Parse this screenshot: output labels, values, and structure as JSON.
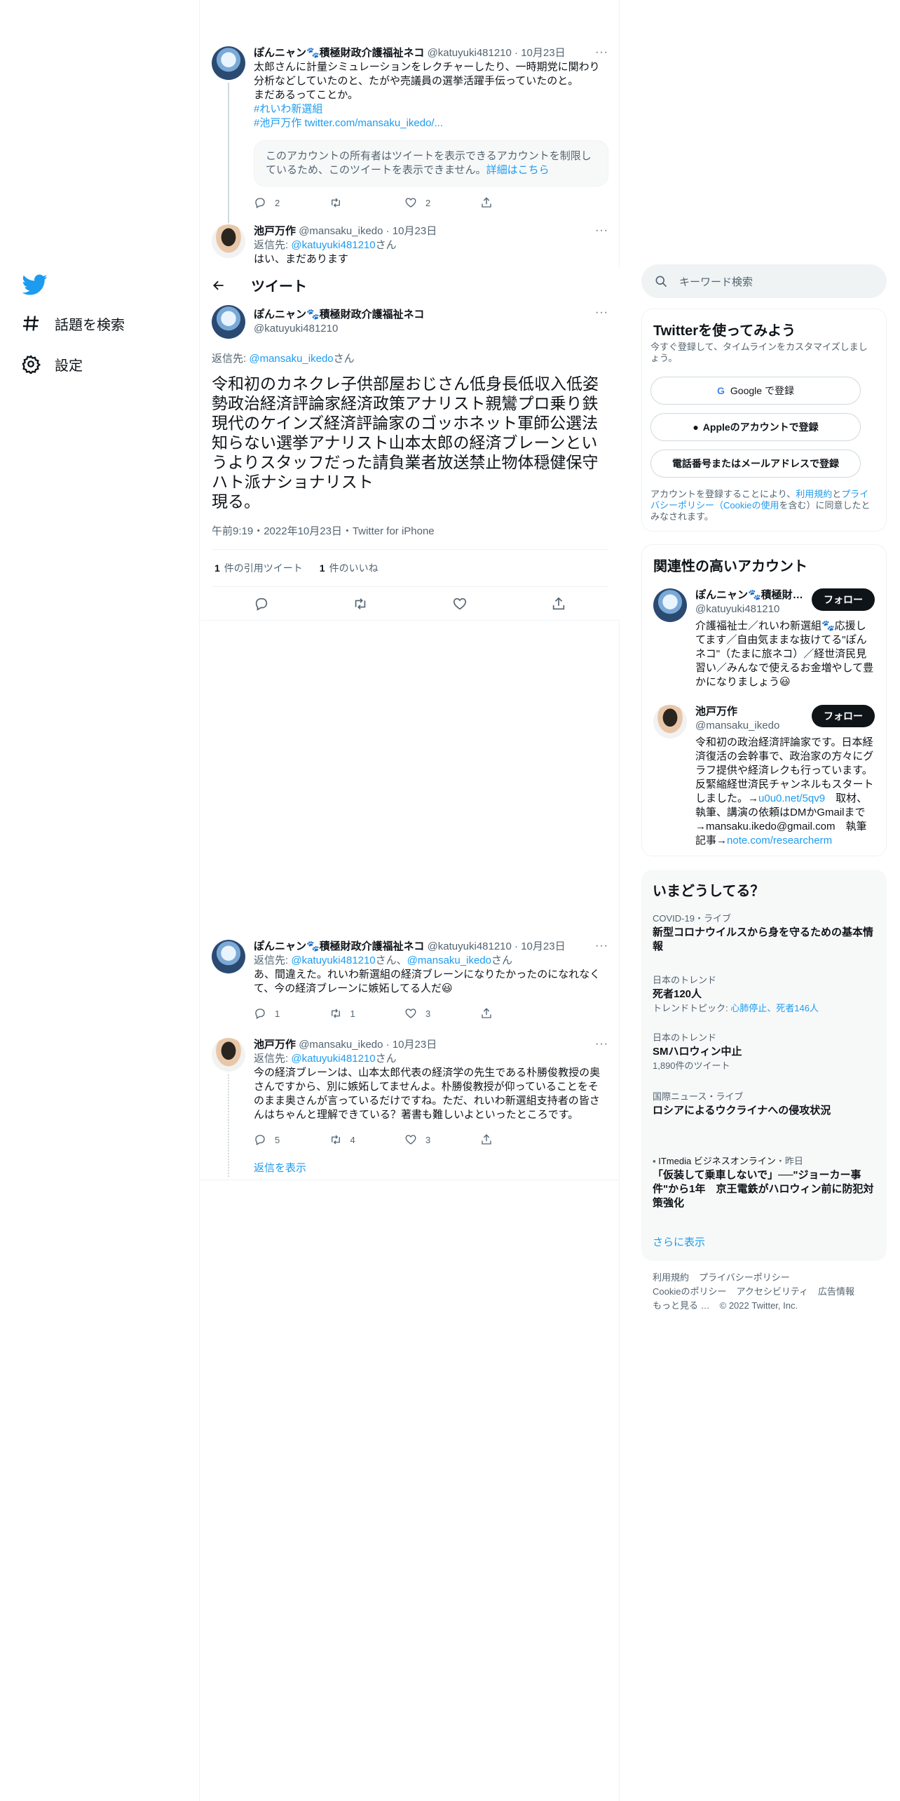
{
  "nav": {
    "search_topics": "話題を検索",
    "settings": "設定"
  },
  "thread_top": {
    "author": "ぽんニャン🐾積極財政介護福祉ネコ",
    "handle": "@katuyuki481210",
    "date": "10月23日",
    "text": [
      "太郎さんに計量シミュレーションをレクチャーしたり、一時期党に関わり",
      "分析などしていたのと、たがや売議員の選挙活躍手伝っていたのと。",
      "まだあるってことか。"
    ],
    "hashtag": "#れいわ新選組",
    "link_line": "#池戸万作 twitter.com/mansaku_ikedo/...",
    "notice": "このアカウントの所有者はツイートを表示できるアカウントを制限しているため、このツイートを表示できません。",
    "notice_link": "詳細はこちら",
    "replies": "2",
    "likes": "2"
  },
  "thread_second": {
    "author": "池戸万作",
    "handle": "@mansaku_ikedo",
    "date": "10月23日",
    "reply_prefix": "返信先:",
    "reply_to": "@katuyuki481210",
    "reply_suffix": "さん",
    "text": "はい、まだあります"
  },
  "header": {
    "title": "ツイート"
  },
  "main": {
    "author": "ぽんニャン🐾積極財政介護福祉ネコ",
    "handle": "@katuyuki481210",
    "reply_prefix": "返信先:",
    "reply_to": "@mansaku_ikedo",
    "reply_suffix": "さん",
    "text": "令和初のカネクレ子供部屋おじさん低身長低収入低姿勢政治経済評論家経済政策アナリスト親鸞プロ乗り鉄現代のケインズ経済評論家のゴッホネット軍師公選法知らない選挙アナリスト山本太郎の経済ブレーンというよりスタッフだった請負業者放送禁止物体穏健保守ハト派ナショナリスト\n現る。",
    "meta": "午前9:19・2022年10月23日・Twitter for iPhone",
    "quote_count": "1",
    "quote_label": "件の引用ツイート",
    "like_count": "1",
    "like_label": "件のいいね"
  },
  "replies": [
    {
      "author": "ぽんニャン🐾積極財政介護福祉ネコ",
      "handle": "@katuyuki481210",
      "date": "10月23日",
      "reply_prefix": "返信先:",
      "reply_to_1": "@katuyuki481210",
      "reply_mid": "さん、",
      "reply_to_2": "@mansaku_ikedo",
      "reply_suffix": "さん",
      "text": "あ、間違えた。れいわ新選組の経済ブレーンになりたかったのになれなくて、今の経済ブレーンに嫉妬してる人だ😃",
      "replies": "1",
      "retweets": "1",
      "likes": "3"
    },
    {
      "author": "池戸万作",
      "handle": "@mansaku_ikedo",
      "date": "10月23日",
      "reply_prefix": "返信先:",
      "reply_to": "@katuyuki481210",
      "reply_suffix": "さん",
      "text": "今の経済ブレーンは、山本太郎代表の経済学の先生である朴勝俊教授の奥さんですから、別に嫉妬してませんよ。朴勝俊教授が仰っていることをそのまま奥さんが言っているだけですね。ただ、れいわ新選組支持者の皆さんはちゃんと理解できている？著書も難しいよといったところです。",
      "replies": "5",
      "retweets": "4",
      "likes": "3"
    }
  ],
  "show_replies": "返信を表示",
  "right": {
    "search_placeholder": "キーワード検索",
    "signup": {
      "title": "Twitterを使ってみよう",
      "subtitle": "今すぐ登録して、タイムラインをカスタマイズしましょう。",
      "google": "Google で登録",
      "apple": "Appleのアカウントで登録",
      "phone": "電話番号またはメールアドレスで登録",
      "legal_1": "アカウントを登録することにより、",
      "terms": "利用規約",
      "and": "と",
      "privacy": "プライバシーポリシー（Cookieの使用",
      "legal_2": "を含む）に同意したとみなされます。"
    },
    "related": {
      "title": "関連性の高いアカウント",
      "follow": "フォロー",
      "accounts": [
        {
          "name": "ぽんニャン🐾積極財政…",
          "handle": "@katuyuki481210",
          "bio": "介護福祉士／れいわ新選組🐾応援してます／自由気ままな抜けてる\"ぽんネコ\"（たまに旅ネコ）／経世済民見習い／みんなで使えるお金増やして豊かになりましょう😃"
        },
        {
          "name": "池戸万作",
          "handle": "@mansaku_ikedo",
          "bio_1": "令和初の政治経済評論家です。日本経済復活の会幹事で、政治家の方々にグラフ提供や経済レクも行っています。反緊縮経世済民チャンネルもスタートしました。→",
          "bio_link_1": "u0u0.net/5qv9",
          "bio_2": "　取材、執筆、講演の依頼はDMかGmailまで→mansaku.ikedo@gmail.com　執筆記事→",
          "bio_link_2": "note.com/researcherm"
        }
      ]
    },
    "trends": {
      "title": "いまどうしてる？",
      "items": [
        {
          "context": "COVID-19・ライブ",
          "title": "新型コロナウイルスから身を守るための基本情報"
        },
        {
          "context": "日本のトレンド",
          "title": "死者120人",
          "sub_prefix": "トレンドトピック: ",
          "sub_link": "心肺停止、死者146人"
        },
        {
          "context": "日本のトレンド",
          "title": "SMハロウィン中止",
          "sub": "1,890件のツイート"
        },
        {
          "context": "国際ニュース・ライブ",
          "title": "ロシアによるウクライナへの侵攻状況"
        },
        {
          "context_source": "ITmedia ビジネスオンライン",
          "context_time": "・昨日",
          "title": "「仮装して乗車しないで」──\"ジョーカー事件\"から1年　京王電鉄がハロウィン前に防犯対策強化"
        }
      ],
      "show_more": "さらに表示"
    },
    "footer": {
      "links_1": [
        "利用規約",
        "プライバシーポリシー"
      ],
      "links_2": [
        "Cookieのポリシー",
        "アクセシビリティ",
        "広告情報"
      ],
      "more": "もっと見る …",
      "copyright": "© 2022 Twitter, Inc."
    }
  }
}
